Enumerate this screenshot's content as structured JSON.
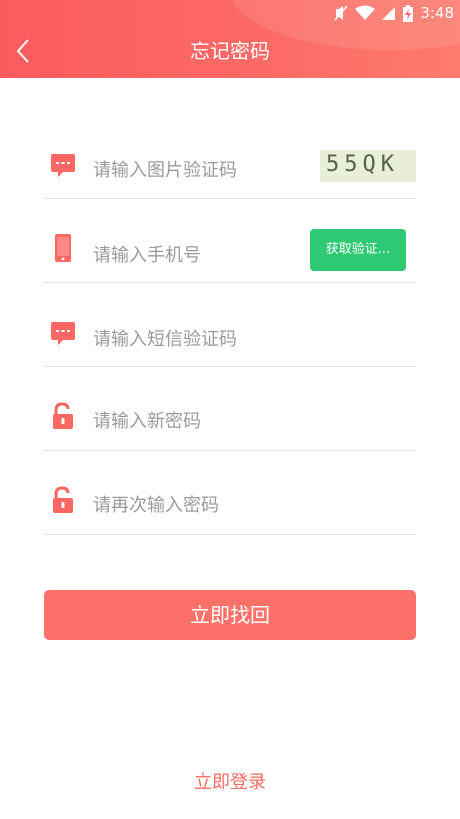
{
  "statusbar": {
    "time": "3:48"
  },
  "header": {
    "title": "忘记密码"
  },
  "form": {
    "captcha_placeholder": "请输入图片验证码",
    "captcha_image_text": "55QK",
    "phone_placeholder": "请输入手机号",
    "get_code_label": "获取验证...",
    "sms_placeholder": "请输入短信验证码",
    "new_password_placeholder": "请输入新密码",
    "confirm_password_placeholder": "请再次输入密码",
    "submit_label": "立即找回"
  },
  "footer": {
    "login_label": "立即登录"
  },
  "colors": {
    "brand": "#fb6762",
    "button": "#fb7169",
    "sms_button": "#2fc974"
  },
  "icons": {
    "back": "chevron-left-icon",
    "captcha": "message-icon",
    "phone": "phone-icon",
    "sms": "message-icon",
    "password": "unlock-icon"
  }
}
